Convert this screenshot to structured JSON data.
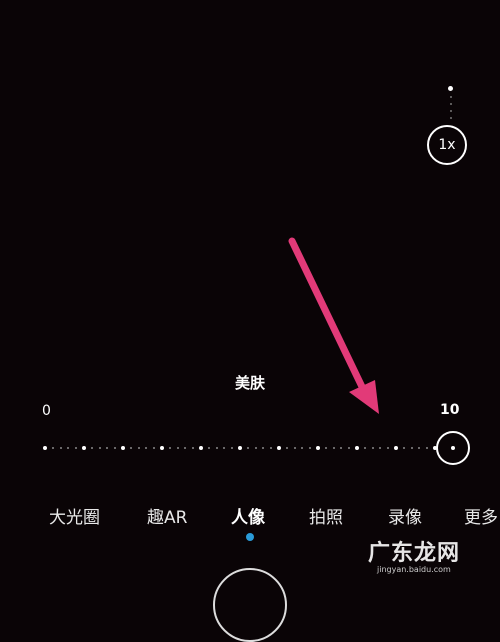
{
  "zoom": {
    "label": "1x"
  },
  "beauty_slider": {
    "title": "美肤",
    "min_label": "0",
    "max_label": "10",
    "value": 10,
    "min": 0,
    "max": 10
  },
  "modes": {
    "items": [
      "大光圈",
      "趣AR",
      "人像",
      "拍照",
      "录像",
      "更多"
    ],
    "active": "人像"
  },
  "colors": {
    "background": "#0a0406",
    "arrow": "#e23a78",
    "active_indicator": "#2a9bd8"
  },
  "watermark": {
    "text": "广东龙网",
    "sub": "jingyan.baidu.com"
  }
}
